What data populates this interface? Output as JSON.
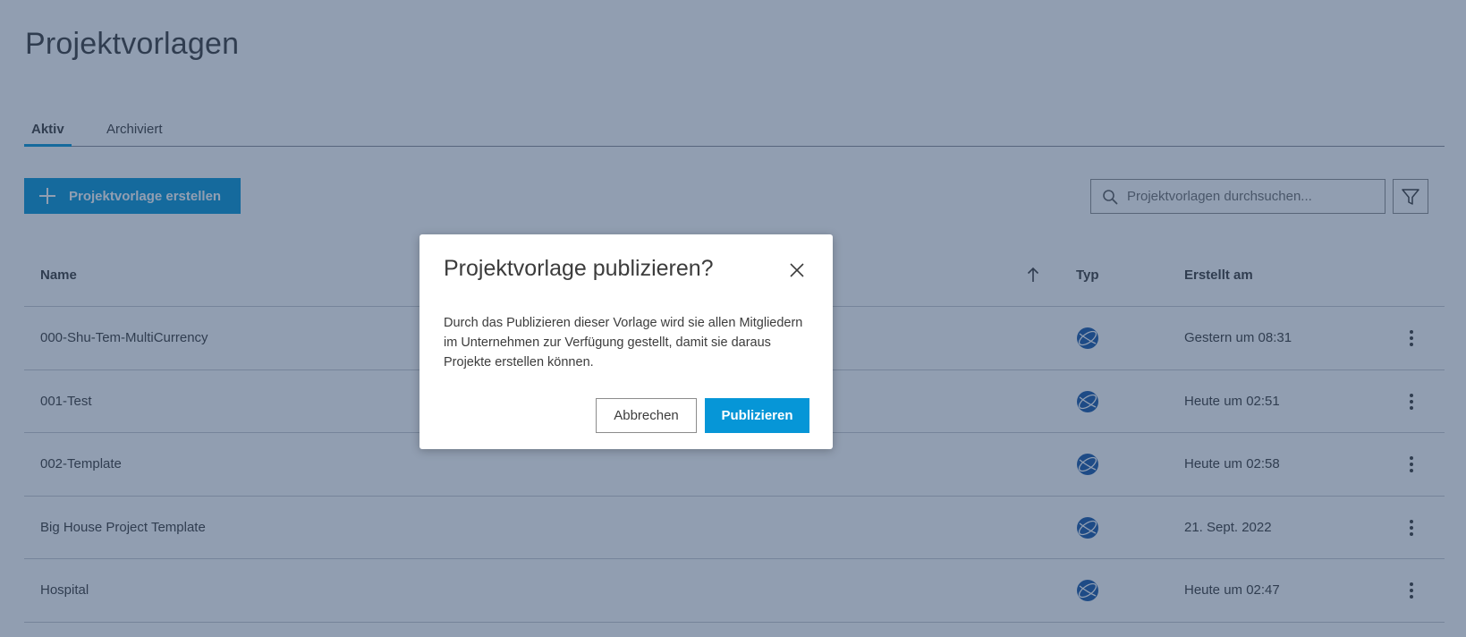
{
  "page": {
    "title": "Projektvorlagen"
  },
  "tabs": [
    {
      "label": "Aktiv",
      "active": true
    },
    {
      "label": "Archiviert",
      "active": false
    }
  ],
  "toolbar": {
    "create_label": "Projektvorlage erstellen",
    "search_placeholder": "Projektvorlagen durchsuchen..."
  },
  "table": {
    "headers": {
      "name": "Name",
      "typ": "Typ",
      "created": "Erstellt am"
    },
    "rows": [
      {
        "name": "000-Shu-Tem-MultiCurrency",
        "typ_icon": "globe-icon",
        "created": "Gestern um 08:31"
      },
      {
        "name": "001-Test",
        "typ_icon": "globe-icon",
        "created": "Heute um 02:51"
      },
      {
        "name": "002-Template",
        "typ_icon": "globe-icon",
        "created": "Heute um 02:58"
      },
      {
        "name": "Big House Project Template",
        "typ_icon": "globe-icon",
        "created": "21. Sept. 2022"
      },
      {
        "name": "Hospital",
        "typ_icon": "globe-icon",
        "created": "Heute um 02:47"
      }
    ]
  },
  "modal": {
    "title": "Projektvorlage publizieren?",
    "body": "Durch das Publizieren dieser Vorlage wird sie allen Mitgliedern im Unternehmen zur Verfügung gestellt, damit sie daraus Projekte erstellen können.",
    "cancel_label": "Abbrechen",
    "publish_label": "Publizieren"
  },
  "colors": {
    "accent": "#0696d7",
    "globe": "#1858a8",
    "overlay": "#233e64"
  }
}
